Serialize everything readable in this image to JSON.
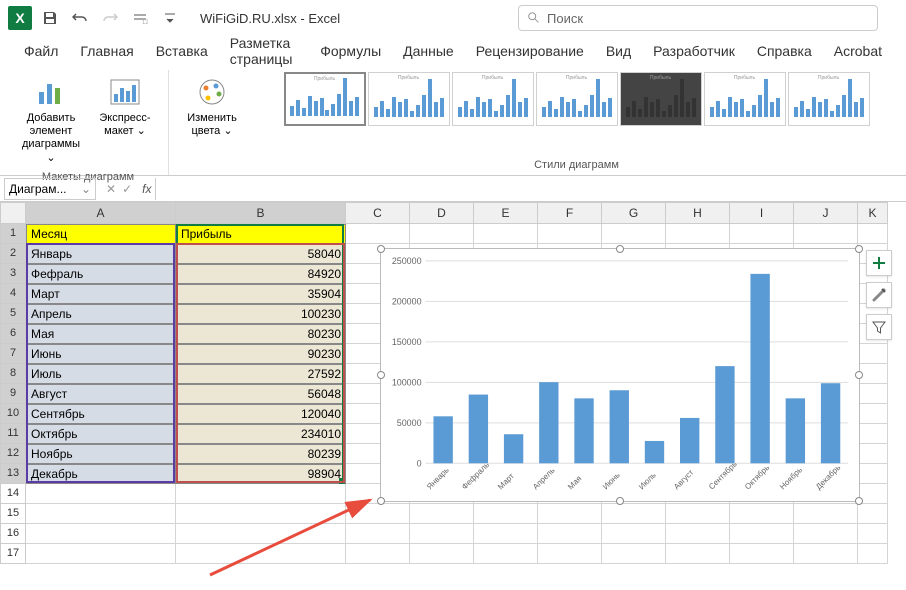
{
  "title": "WiFiGiD.RU.xlsx - Excel",
  "search_placeholder": "Поиск",
  "ribbon": {
    "tabs": [
      "Файл",
      "Главная",
      "Вставка",
      "Разметка страницы",
      "Формулы",
      "Данные",
      "Рецензирование",
      "Вид",
      "Разработчик",
      "Справка",
      "Acrobat"
    ],
    "group1_label": "Макеты диаграмм",
    "group2_label": "Стили диаграмм",
    "btn_add_element": "Добавить элемент диаграммы",
    "btn_express": "Экспресс-макет",
    "btn_colors": "Изменить цвета"
  },
  "namebox": "Диаграм...",
  "columns": [
    "A",
    "B",
    "C",
    "D",
    "E",
    "F",
    "G",
    "H",
    "I",
    "J",
    "K"
  ],
  "table": {
    "header_month": "Месяц",
    "header_profit": "Прибыль",
    "rows": [
      {
        "m": "Январь",
        "v": 58040
      },
      {
        "m": "Фефраль",
        "v": 84920
      },
      {
        "m": "Март",
        "v": 35904
      },
      {
        "m": "Апрель",
        "v": 100230
      },
      {
        "m": "Мая",
        "v": 80230
      },
      {
        "m": "Июнь",
        "v": 90230
      },
      {
        "m": "Июль",
        "v": 27592
      },
      {
        "m": "Август",
        "v": 56048
      },
      {
        "m": "Сентябрь",
        "v": 120040
      },
      {
        "m": "Октябрь",
        "v": 234010
      },
      {
        "m": "Ноябрь",
        "v": 80239
      },
      {
        "m": "Декабрь",
        "v": 98904
      }
    ]
  },
  "chart_data": {
    "type": "bar",
    "title": "",
    "xlabel": "",
    "ylabel": "",
    "ylim": [
      0,
      250000
    ],
    "yticks": [
      0,
      50000,
      100000,
      150000,
      200000,
      250000
    ],
    "categories": [
      "Январь",
      "Фефраль",
      "Март",
      "Апрель",
      "Мая",
      "Июнь",
      "Июль",
      "Август",
      "Сентябрь",
      "Октябрь",
      "Ноябрь",
      "Декабрь"
    ],
    "values": [
      58040,
      84920,
      35904,
      100230,
      80230,
      90230,
      27592,
      56048,
      120040,
      234010,
      80239,
      98904
    ],
    "bar_color": "#5b9bd5"
  }
}
